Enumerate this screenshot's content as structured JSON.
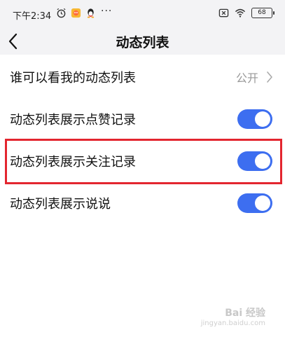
{
  "status_bar": {
    "time": "下午2:34",
    "dots": "···",
    "battery": "68",
    "icons": [
      "alarm-icon",
      "app-icon",
      "qq-penguin-icon",
      "close-box-icon",
      "wifi-icon",
      "battery-icon"
    ]
  },
  "header": {
    "title": "动态列表",
    "back_icon": "chevron-left-icon"
  },
  "settings": [
    {
      "label": "谁可以看我的动态列表",
      "value": "公开",
      "type": "link"
    },
    {
      "label": "动态列表展示点赞记录",
      "type": "toggle",
      "on": true
    },
    {
      "label": "动态列表展示关注记录",
      "type": "toggle",
      "on": true,
      "highlighted": true
    },
    {
      "label": "动态列表展示说说",
      "type": "toggle",
      "on": true
    }
  ],
  "colors": {
    "toggle_on": "#3d6ef0",
    "highlight_border": "#e3262f",
    "header_bg": "#f3f3f5"
  },
  "watermark": {
    "brand": "Bai 经验",
    "url": "jingyan.baidu.com"
  }
}
